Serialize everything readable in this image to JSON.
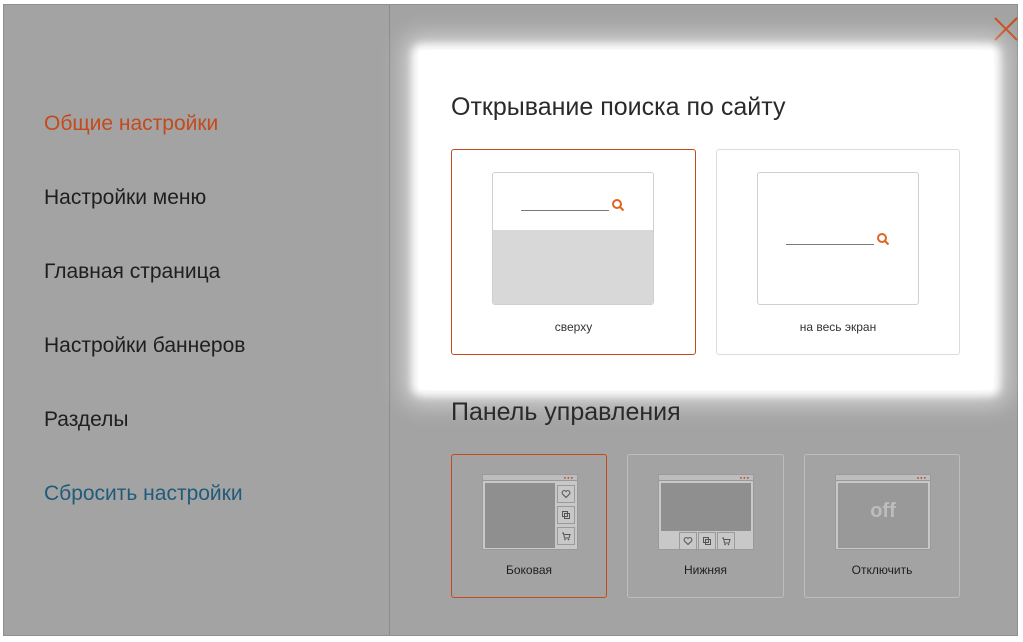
{
  "sidebar": {
    "items": [
      {
        "label": "Общие настройки",
        "state": "active"
      },
      {
        "label": "Настройки меню"
      },
      {
        "label": "Главная страница"
      },
      {
        "label": "Настройки баннеров"
      },
      {
        "label": "Разделы"
      },
      {
        "label": "Сбросить настройки",
        "state": "reset"
      }
    ]
  },
  "search_open": {
    "title": "Открывание поиска по сайту",
    "options": [
      {
        "label": "сверху",
        "selected": true
      },
      {
        "label": "на весь экран",
        "selected": false
      }
    ]
  },
  "control_panel": {
    "title": "Панель управления",
    "options": [
      {
        "label": "Боковая",
        "selected": true
      },
      {
        "label": "Нижняя",
        "selected": false
      },
      {
        "label": "Отключить",
        "selected": false,
        "preview_text": "off"
      }
    ]
  },
  "colors": {
    "accent": "#c44a1c",
    "reset_link": "#1f5b7a",
    "overlay": "#a3a3a3"
  },
  "icons": {
    "close": "close-icon",
    "search": "search-icon",
    "heart": "heart-icon",
    "compare": "compare-icon",
    "cart": "cart-icon"
  }
}
